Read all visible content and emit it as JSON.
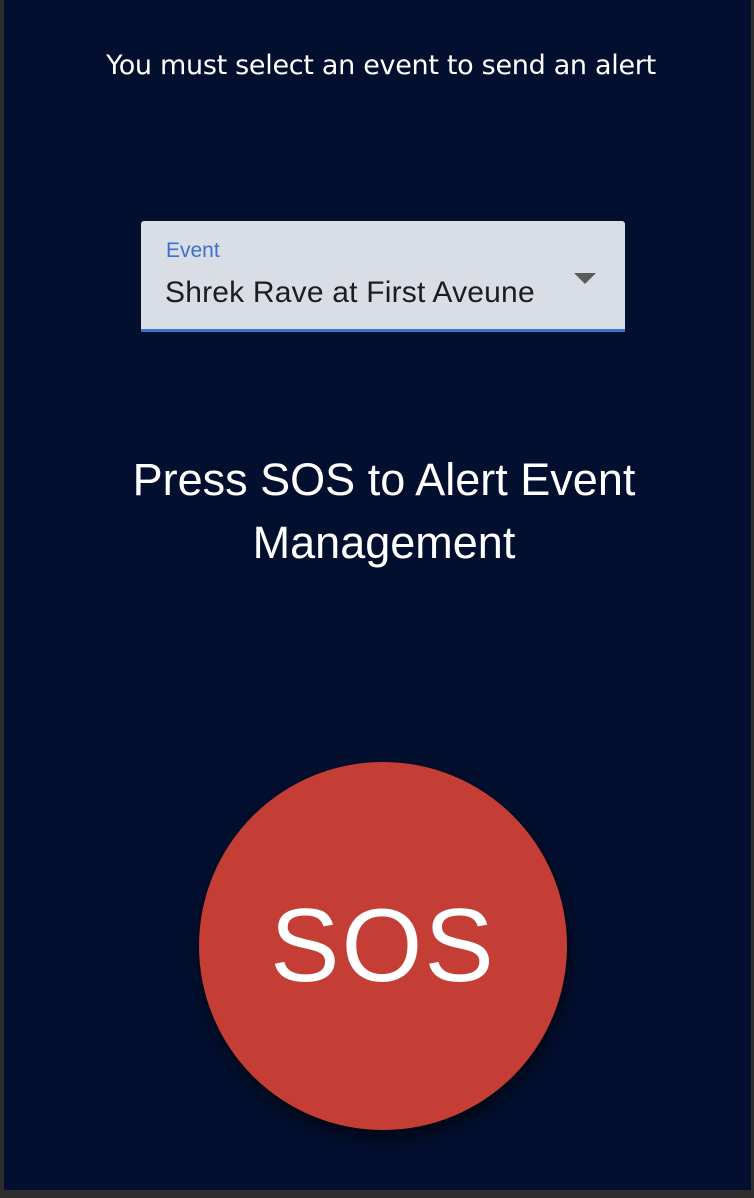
{
  "warning_text": "You must select an event to send an alert",
  "event_select": {
    "label": "Event",
    "value": "Shrek Rave at First Aveune",
    "caret_icon": "caret-down-icon"
  },
  "prompt_text": "Press SOS to Alert Event Management",
  "sos_button": {
    "label": "SOS"
  },
  "colors": {
    "background": "#020f2f",
    "sos": "#c43e35",
    "accent": "#3a72c8",
    "select_bg": "#d9dde5"
  }
}
